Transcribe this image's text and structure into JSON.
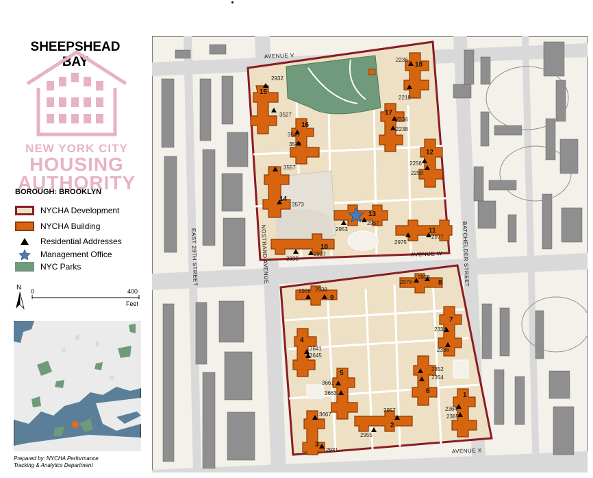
{
  "title": {
    "line1": "SHEEPSHEAD",
    "line2": "BAY"
  },
  "agency": {
    "line1": "NEW YORK CITY",
    "line2": "HOUSING",
    "line3": "AUTHORITY"
  },
  "borough": "BOROUGH: BROOKLYN",
  "legend": {
    "development": "NYCHA Development",
    "building": "NYCHA Building",
    "residential": "Residential Addresses",
    "office": "Management Office",
    "parks": "NYC Parks"
  },
  "scale": {
    "north": "N",
    "start": "0",
    "end": "400",
    "unit": "Feet"
  },
  "credit": {
    "line1": "Prepared by: NYCHA Performance",
    "line2": "Tracking & Analytics Department"
  },
  "colors": {
    "development_fill": "#ede0c4",
    "development_border": "#8a1c24",
    "building_fill": "#d7650f",
    "building_border": "#8a3a06",
    "park": "#6f9a7b",
    "other_building": "#8f8f8f",
    "logo_pink": "#e7b3c3"
  },
  "streets": {
    "avenue_v": "AVENUE V",
    "avenue_w": "AVENUE W",
    "avenue_x": "AVENUE X",
    "nostrand": "NOSTRAND AVENUE",
    "east29": "EAST 29TH STREET",
    "batchelder": "BATCHELDER STREET"
  },
  "buildings": [
    {
      "id": "b1",
      "label": "1"
    },
    {
      "id": "b2",
      "label": "2"
    },
    {
      "id": "b3",
      "label": "3"
    },
    {
      "id": "b4",
      "label": "4"
    },
    {
      "id": "b5",
      "label": "5"
    },
    {
      "id": "b6",
      "label": "6"
    },
    {
      "id": "b7",
      "label": "7"
    },
    {
      "id": "b8",
      "label": "8"
    },
    {
      "id": "b9",
      "label": "9"
    },
    {
      "id": "b10",
      "label": "10"
    },
    {
      "id": "b11",
      "label": "11"
    },
    {
      "id": "b12",
      "label": "12"
    },
    {
      "id": "b13",
      "label": "13"
    },
    {
      "id": "b14",
      "label": "14"
    },
    {
      "id": "b15",
      "label": "15"
    },
    {
      "id": "b16",
      "label": "16"
    },
    {
      "id": "b17",
      "label": "17"
    },
    {
      "id": "b18",
      "label": "18"
    }
  ],
  "addresses": [
    "2932",
    "3527",
    "3547",
    "3549",
    "3557",
    "3573",
    "2935",
    "2937",
    "2953",
    "2957",
    "2975",
    "2977",
    "2256",
    "2258",
    "2236",
    "2238",
    "2218",
    "2236",
    "2936",
    "2938",
    "2976",
    "2978",
    "3641",
    "3645",
    "3661",
    "3663",
    "3667",
    "2931",
    "2957",
    "2955",
    "2334",
    "2336",
    "2352",
    "2354",
    "2364",
    "2385"
  ]
}
